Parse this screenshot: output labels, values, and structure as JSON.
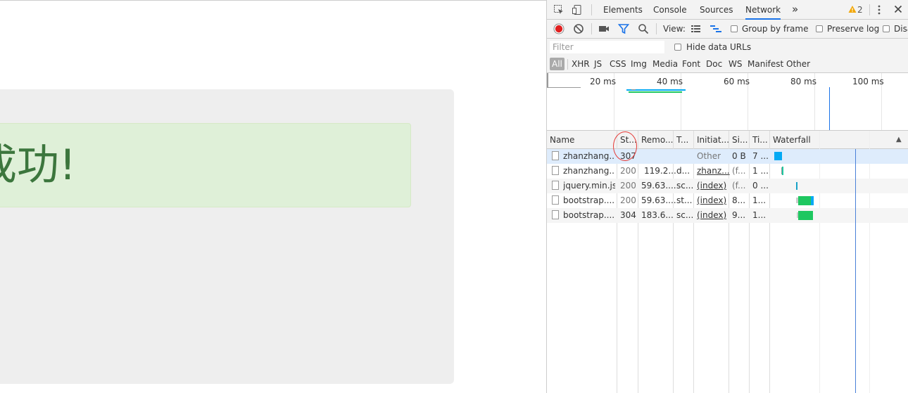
{
  "page": {
    "success_message": "成功!"
  },
  "devtools": {
    "tabs": [
      {
        "label": "Elements"
      },
      {
        "label": "Console"
      },
      {
        "label": "Sources"
      },
      {
        "label": "Network"
      }
    ],
    "active_tab": "Network",
    "more_tabs_glyph": "»",
    "warning_count": "2",
    "toolbar": {
      "view_label": "View:",
      "group_by_frame": "Group by frame",
      "preserve_log": "Preserve log",
      "disable_cache": "Disa"
    },
    "filter": {
      "placeholder": "Filter",
      "hide_data_urls": "Hide data URLs"
    },
    "types": [
      "All",
      "XHR",
      "JS",
      "CSS",
      "Img",
      "Media",
      "Font",
      "Doc",
      "WS",
      "Manifest",
      "Other"
    ],
    "overview_ticks": [
      "20 ms",
      "40 ms",
      "60 ms",
      "80 ms",
      "100 ms"
    ],
    "columns": [
      "Name",
      "St...",
      "Remo...",
      "T...",
      "Initiat...",
      "Si...",
      "Ti...",
      "Waterfall"
    ],
    "sort_glyph": "▲",
    "rows": [
      {
        "name": "zhanzhang....",
        "status": "307",
        "remote": "",
        "type": "",
        "initiator": "Other",
        "size": "0 B",
        "time": "7 ..."
      },
      {
        "name": "zhanzhang....",
        "status": "200",
        "remote": "119.2...",
        "type": "d...",
        "initiator": "zhanz...",
        "size": "(f...",
        "time": "1 ..."
      },
      {
        "name": "jquery.min.js",
        "status": "200",
        "remote": "59.63....",
        "type": "sc...",
        "initiator": "(index)",
        "size": "(f...",
        "time": "0 ..."
      },
      {
        "name": "bootstrap....",
        "status": "200",
        "remote": "59.63....",
        "type": "st...",
        "initiator": "(index)",
        "size": "8...",
        "time": "1..."
      },
      {
        "name": "bootstrap....",
        "status": "304",
        "remote": "183.6...",
        "type": "sc...",
        "initiator": "(index)",
        "size": "9...",
        "time": "1..."
      }
    ],
    "colors": {
      "record": "#e02020",
      "accent": "#1a73e8",
      "bar_blue": "#03a9f4",
      "bar_green": "#1ec760",
      "annotation": "#e53935"
    }
  }
}
